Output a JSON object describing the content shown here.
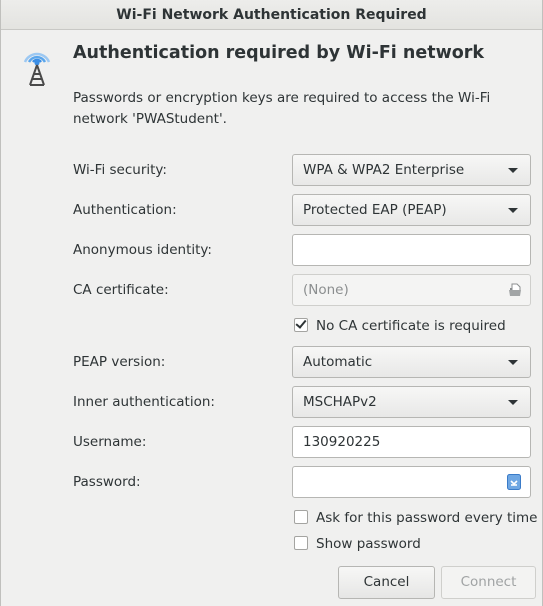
{
  "window": {
    "title": "Wi-Fi Network Authentication Required"
  },
  "header": {
    "title": "Authentication required by Wi-Fi network",
    "description": "Passwords or encryption keys are required to access the Wi-Fi network 'PWAStudent'."
  },
  "form": {
    "security": {
      "label": "Wi-Fi security:",
      "value": "WPA & WPA2 Enterprise"
    },
    "authentication": {
      "label": "Authentication:",
      "value": "Protected EAP (PEAP)"
    },
    "anonymous_identity": {
      "label": "Anonymous identity:",
      "value": ""
    },
    "ca_certificate": {
      "label": "CA certificate:",
      "value": "(None)"
    },
    "no_ca_required": {
      "label": "No CA certificate is required",
      "checked": true
    },
    "peap_version": {
      "label": "PEAP version:",
      "value": "Automatic"
    },
    "inner_auth": {
      "label": "Inner authentication:",
      "value": "MSCHAPv2"
    },
    "username": {
      "label": "Username:",
      "value": "130920225"
    },
    "password": {
      "label": "Password:",
      "value": ""
    },
    "ask_password": {
      "label": "Ask for this password every time",
      "checked": false
    },
    "show_password": {
      "label": "Show password",
      "checked": false
    }
  },
  "buttons": {
    "cancel": "Cancel",
    "connect": "Connect"
  },
  "colors": {
    "background": "#f0f0ef",
    "icon_blue": "#3a8ee6",
    "text": "#2e3436"
  },
  "icons": {
    "network": "wifi-tower-icon",
    "file": "file-chooser-icon",
    "key": "keyring-icon"
  }
}
